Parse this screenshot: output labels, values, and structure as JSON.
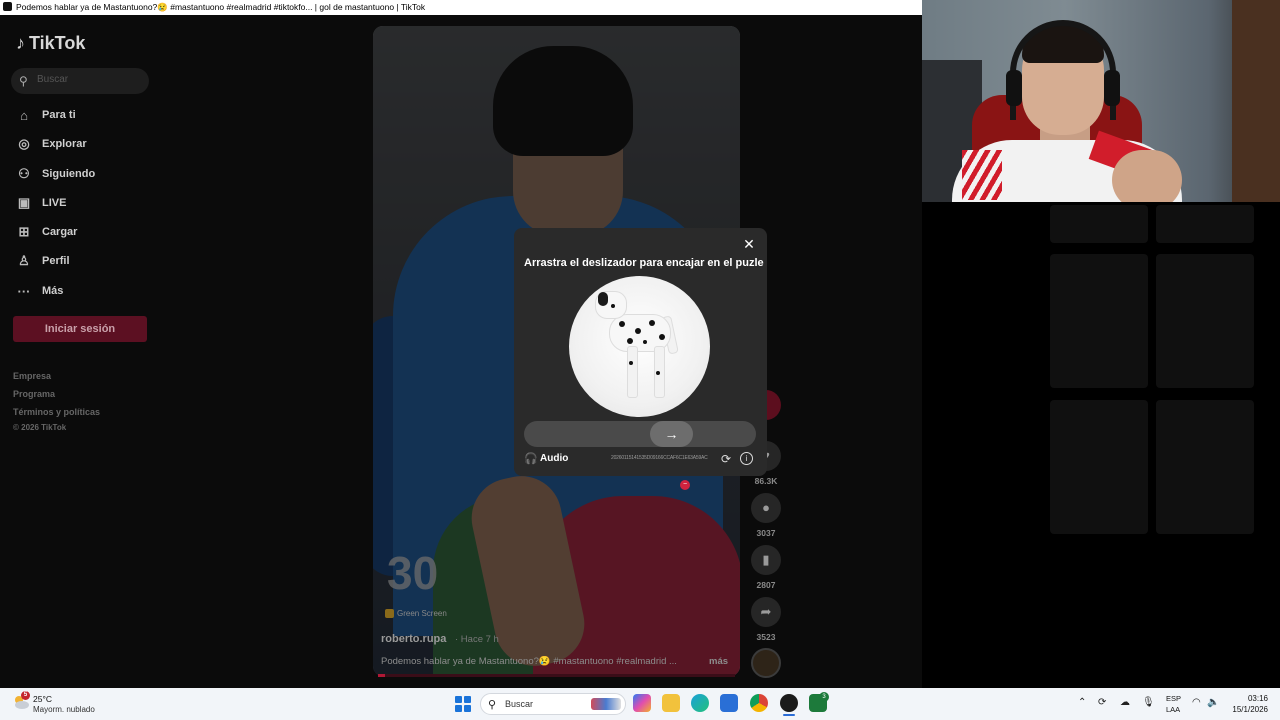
{
  "window": {
    "title": "Podemos hablar ya de Mastantuono?😢 #mastantuono #realmadrid #tiktokfo... | gol de mastantuono | TikTok"
  },
  "sidebar": {
    "logo": "TikTok",
    "search_placeholder": "Buscar",
    "items": [
      {
        "label": "Para ti",
        "icon": "home-icon"
      },
      {
        "label": "Explorar",
        "icon": "compass-icon"
      },
      {
        "label": "Siguiendo",
        "icon": "following-icon"
      },
      {
        "label": "LIVE",
        "icon": "live-icon"
      },
      {
        "label": "Cargar",
        "icon": "upload-icon"
      },
      {
        "label": "Perfil",
        "icon": "profile-icon"
      },
      {
        "label": "Más",
        "icon": "more-icon"
      }
    ],
    "login_button": "Iniciar sesión",
    "footer_links": [
      "Empresa",
      "Programa",
      "Términos y políticas",
      "© 2026 TikTok"
    ]
  },
  "video": {
    "effect_badge": "Green Screen",
    "author": "roberto.rupa",
    "time_ago": "· Hace 7 h",
    "caption": "Podemos hablar ya de Mastantuono?😢 #mastantuono #realmadrid ...",
    "more_label": "más",
    "progress": 0.02,
    "actions": [
      {
        "name": "like",
        "icon": "heart-icon",
        "count": "86.3K"
      },
      {
        "name": "comment",
        "icon": "comment-icon",
        "count": "3037"
      },
      {
        "name": "save",
        "icon": "bookmark-icon",
        "count": "2807"
      },
      {
        "name": "share",
        "icon": "share-icon",
        "count": "3523"
      }
    ]
  },
  "captcha": {
    "title": "Arrastra el deslizador para encajar en el puzle",
    "close_symbol": "✕",
    "slider_arrow": "→",
    "audio_label": "Audio",
    "captcha_id": "20260115141535D09166CCAF6C1E63A59AC",
    "refresh_symbol": "⟳",
    "info_symbol": "i"
  },
  "taskbar": {
    "weather_temp": "25°C",
    "weather_condition": "Mayorm. nublado",
    "weather_badge": "5",
    "search_label": "Buscar",
    "app_badge": "3",
    "lang_line1": "ESP",
    "lang_line2": "LAA",
    "time": "03:16",
    "date": "15/1/2026"
  },
  "colors": {
    "tiktok_red": "#fe2c55",
    "windows_blue": "#1a73d9"
  }
}
